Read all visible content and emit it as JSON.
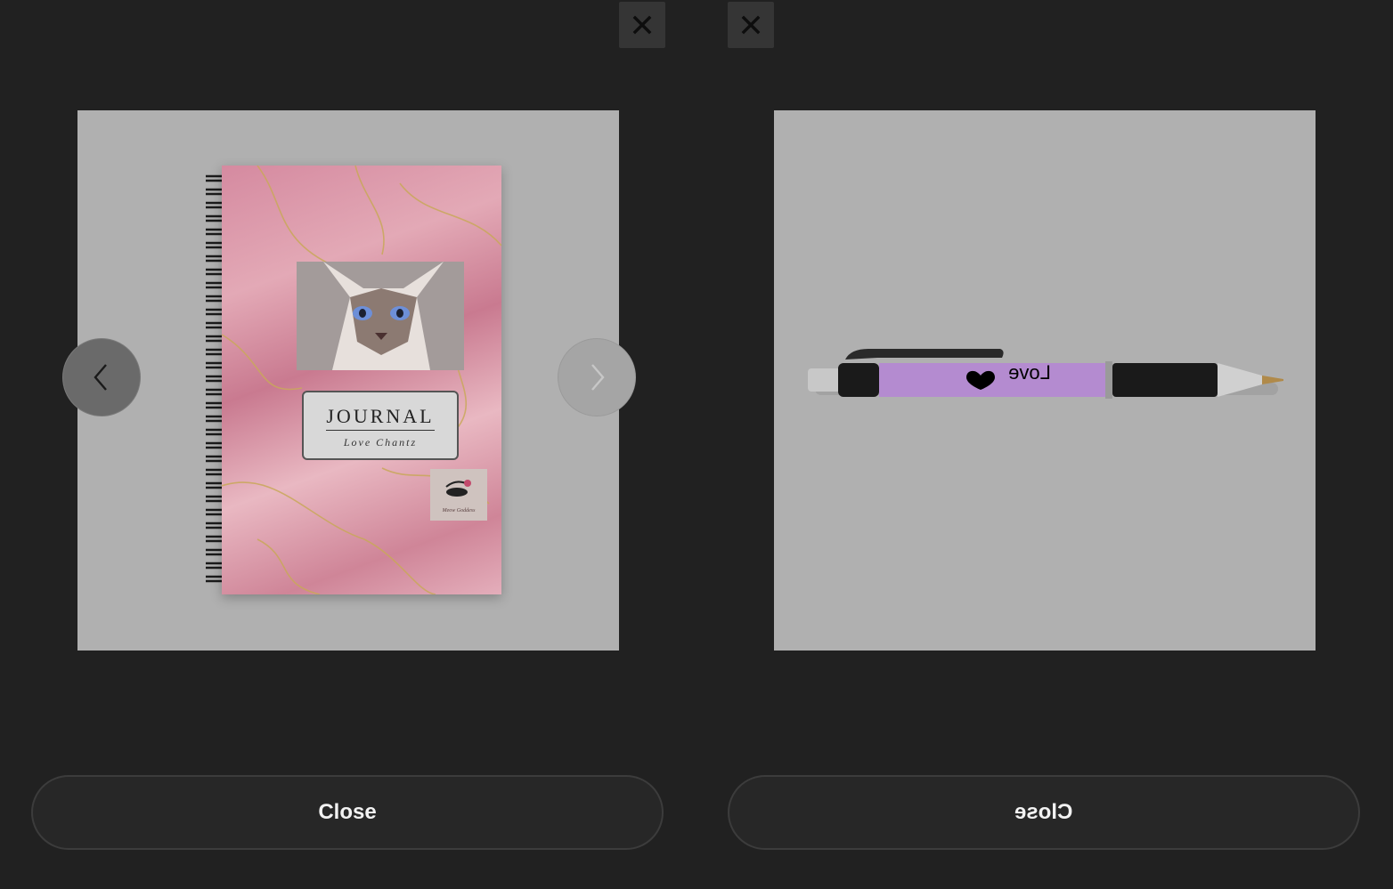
{
  "left_panel": {
    "close_icon": "close-icon",
    "product": {
      "kind": "spiral-notebook",
      "cover_title": "JOURNAL",
      "cover_subtitle": "Love Chantz",
      "stamp_text": "Meow Goddess"
    },
    "prev_icon": "chevron-left-icon",
    "next_icon": "chevron-right-icon",
    "close_label": "Close"
  },
  "right_panel": {
    "close_icon": "close-icon",
    "product": {
      "kind": "pen",
      "barrel_text": "Love",
      "barrel_color": "#b48bd0"
    },
    "close_label": "Close",
    "mirrored": true
  },
  "colors": {
    "background": "#212121",
    "frame": "#b0b0b0",
    "button_text": "#f2f2f2"
  }
}
